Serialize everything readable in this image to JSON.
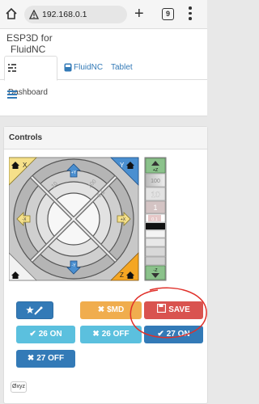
{
  "browser": {
    "url": "192.168.0.1",
    "tab_count": "9",
    "new_tab_glyph": "+"
  },
  "app": {
    "brand_line1": "ESP3D for",
    "brand_line2": "FluidNC",
    "tabs": [
      {
        "label": "Dashboard",
        "icon": "dashboard-icon",
        "active": true
      },
      {
        "label": "FluidNC",
        "icon": "fluidnc-icon"
      },
      {
        "label": "Tablet"
      }
    ]
  },
  "controls": {
    "title": "Controls",
    "jog": {
      "home_x": "X",
      "home_y": "Y",
      "home_z": "Z",
      "plus_y": "+Y",
      "minus_y": "-Y",
      "minus_x": "-X",
      "plus_x": "+X",
      "plus_z": "+Z",
      "minus_z": "-Z",
      "steps": [
        "100",
        "10",
        "1",
        "0.1"
      ],
      "diag_left": "10",
      "diag_top": "100",
      "diag_right": "0.1"
    },
    "buttons": {
      "custom": "",
      "md": "$MD",
      "save": "SAVE",
      "on26": "26 ON",
      "off26": "26 OFF",
      "on27": "27 ON",
      "off27": "27 OFF"
    },
    "zero_xyz": "Øxyz"
  },
  "colors": {
    "blue": "#337ab7",
    "info": "#5bc0de",
    "warning": "#f0ad4e",
    "danger": "#d9534f",
    "annotation": "#e0302a"
  }
}
